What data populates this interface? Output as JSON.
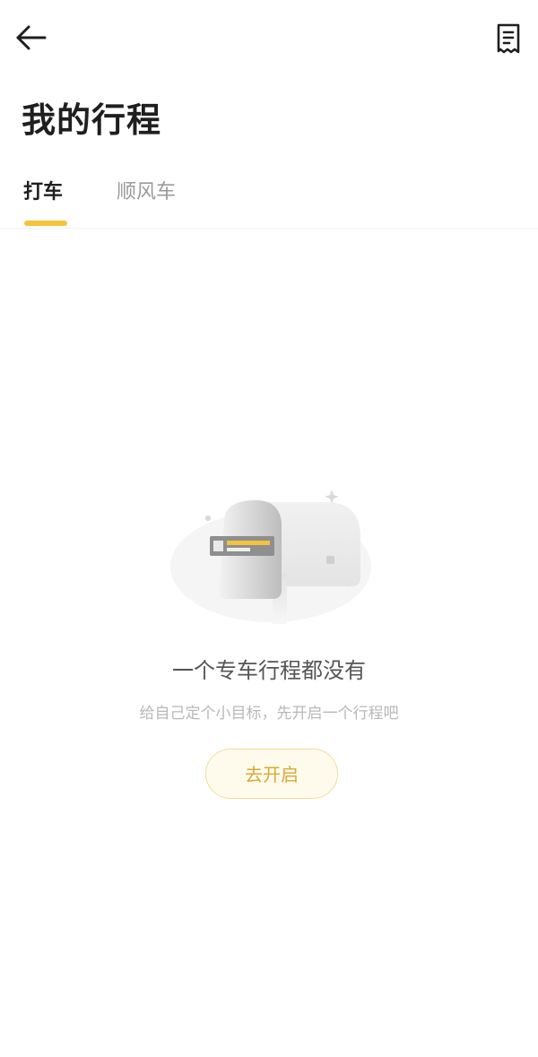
{
  "header": {
    "back_icon": "arrow-left-icon",
    "receipt_icon": "receipt-icon"
  },
  "page_title": "我的行程",
  "tabs": [
    {
      "label": "打车",
      "active": true
    },
    {
      "label": "顺风车",
      "active": false
    }
  ],
  "empty_state": {
    "illustration_icon": "mailbox-icon",
    "title": "一个专车行程都没有",
    "subtitle": "给自己定个小目标，先开启一个行程吧",
    "button_label": "去开启"
  },
  "colors": {
    "accent": "#f5c23b",
    "button_text": "#d8a935",
    "button_bg": "#fffbec",
    "button_border": "#f1dc9b",
    "title_text": "#1f1f1f",
    "muted_text": "#9a9a9a"
  }
}
